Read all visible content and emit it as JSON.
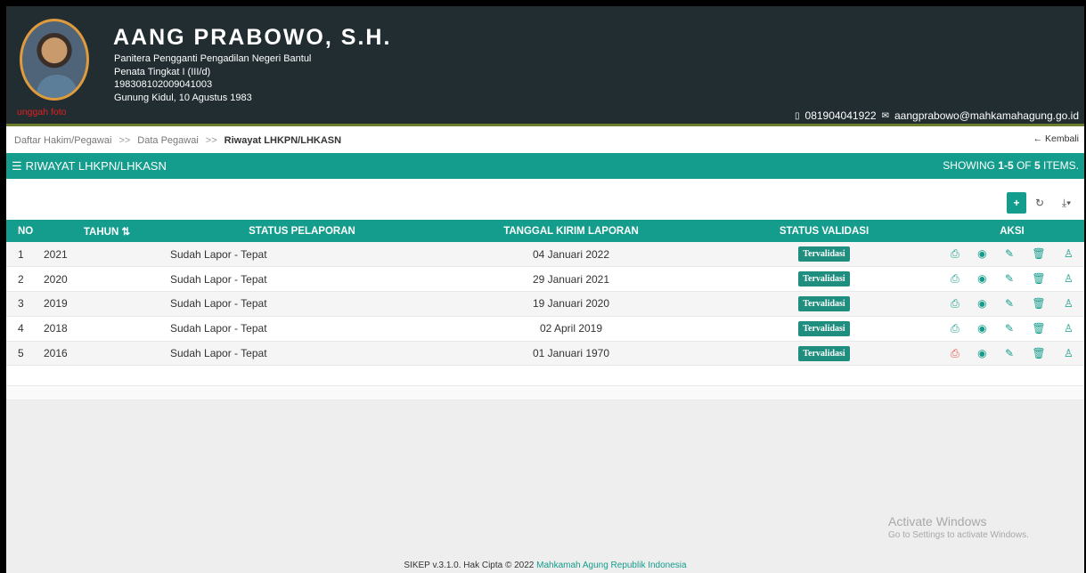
{
  "profile": {
    "name": "AANG PRABOWO, S.H.",
    "position": "Panitera Pengganti Pengadilan Negeri Bantul",
    "rank": "Penata Tingkat I (III/d)",
    "nip": "198308102009041003",
    "birth": "Gunung Kidul, 10 Agustus 1983",
    "upload_label": "unggah foto",
    "phone": "081904041922",
    "email": "aangprabowo@mahkamahagung.go.id"
  },
  "breadcrumb": {
    "item1": "Daftar Hakim/Pegawai",
    "sep": ">>",
    "item2": "Data Pegawai",
    "current": "Riwayat LHKPN/LHKASN",
    "back_label": "← Kembali"
  },
  "panel": {
    "title": "RIWAYAT LHKPN/LHKASN",
    "summary_prefix": "SHOWING ",
    "summary_range": "1-5",
    "summary_mid": " OF ",
    "summary_total": "5",
    "summary_suffix": " ITEMS."
  },
  "toolbar": {
    "add_icon": "plus-icon",
    "refresh_icon": "refresh-icon",
    "export_icon": "export-icon"
  },
  "table": {
    "headers": {
      "no": "NO",
      "year": "TAHUN",
      "status": "STATUS PELAPORAN",
      "date": "TANGGAL KIRIM LAPORAN",
      "validation": "STATUS VALIDASI",
      "actions": "AKSI"
    },
    "rows": [
      {
        "no": "1",
        "year": "2021",
        "status": "Sudah Lapor - Tepat",
        "date": "04 Januari 2022",
        "validation": "Tervalidasi",
        "pdf_color": "#149c8c"
      },
      {
        "no": "2",
        "year": "2020",
        "status": "Sudah Lapor - Tepat",
        "date": "29 Januari 2021",
        "validation": "Tervalidasi",
        "pdf_color": "#149c8c"
      },
      {
        "no": "3",
        "year": "2019",
        "status": "Sudah Lapor - Tepat",
        "date": "19 Januari 2020",
        "validation": "Tervalidasi",
        "pdf_color": "#149c8c"
      },
      {
        "no": "4",
        "year": "2018",
        "status": "Sudah Lapor - Tepat",
        "date": "02 April 2019",
        "validation": "Tervalidasi",
        "pdf_color": "#149c8c"
      },
      {
        "no": "5",
        "year": "2016",
        "status": "Sudah Lapor - Tepat",
        "date": "01 Januari 1970",
        "validation": "Tervalidasi",
        "pdf_color": "#e74c3c"
      }
    ]
  },
  "watermark": {
    "line1": "Activate Windows",
    "line2": "Go to Settings to activate Windows."
  },
  "footer": {
    "text": "SIKEP v.3.1.0. Hak Cipta © 2022 ",
    "link": "Mahkamah Agung Republik Indonesia"
  },
  "colors": {
    "accent": "#149c8c",
    "header_bg": "#222d32",
    "badge": "#1f8e7e"
  }
}
